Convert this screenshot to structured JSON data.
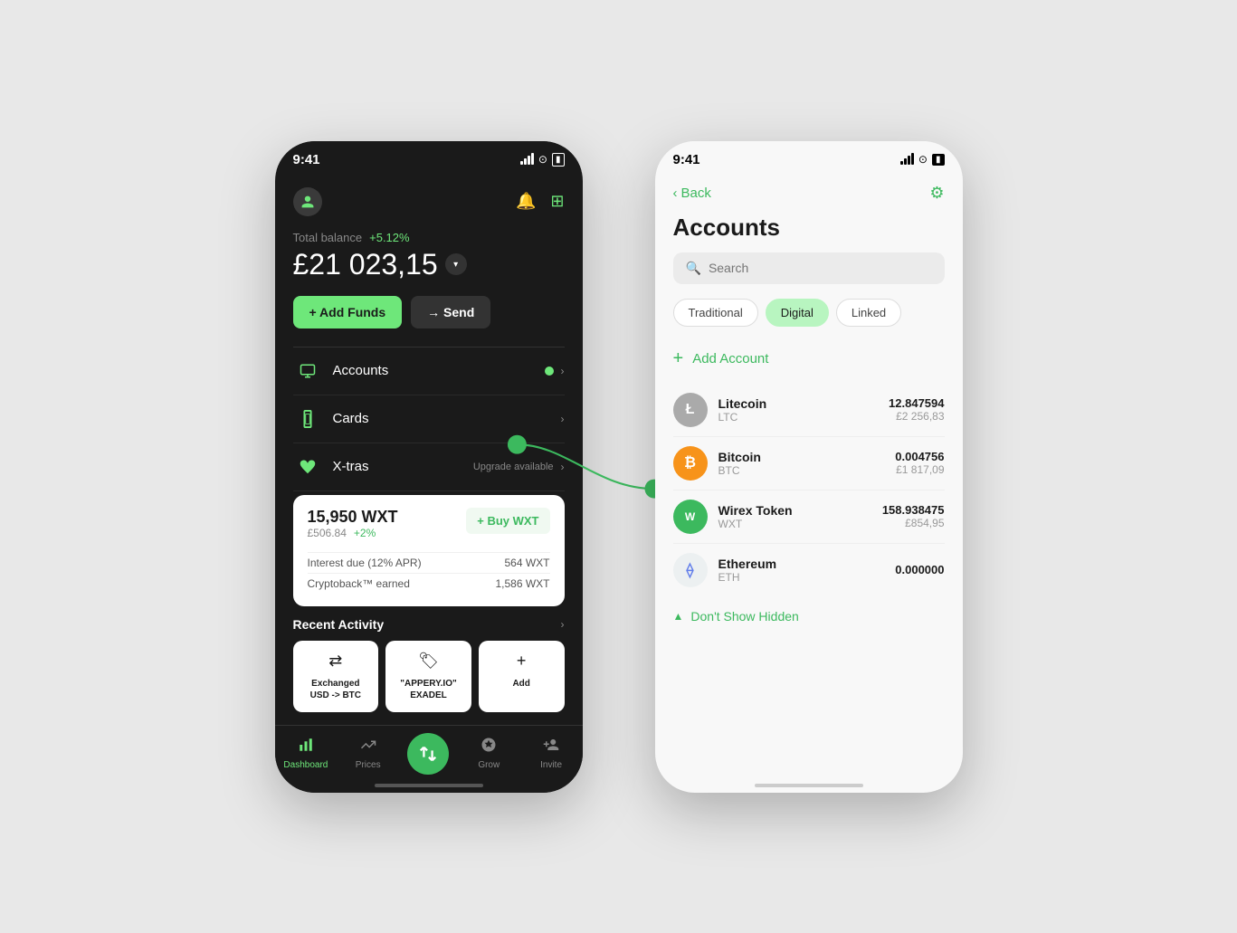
{
  "scene": {
    "background": "#e8e8e8"
  },
  "leftPhone": {
    "statusBar": {
      "time": "9:41"
    },
    "balance": {
      "label": "Total balance",
      "change": "+5.12%",
      "amount": "£21 023,15"
    },
    "buttons": {
      "addFunds": "+ Add Funds",
      "send": "→ Send"
    },
    "menuItems": [
      {
        "label": "Accounts",
        "icon": "accounts"
      },
      {
        "label": "Cards",
        "icon": "cards"
      },
      {
        "label": "X-tras",
        "icon": "xtras",
        "badge": "Upgrade available"
      }
    ],
    "wxtCard": {
      "amount": "15,950 WXT",
      "fiatValue": "£506.84",
      "change": "+2%",
      "buyLabel": "+ Buy WXT",
      "rows": [
        {
          "label": "Interest due (12% APR)",
          "value": "564 WXT"
        },
        {
          "label": "Cryptoback™ earned",
          "value": "1,586 WXT"
        }
      ]
    },
    "recentActivity": {
      "title": "Recent Activity",
      "items": [
        {
          "label": "Exchanged USD -> BTC",
          "icon": "exchange"
        },
        {
          "label": "\"APPERY.IO\" EXADEL",
          "icon": "tag"
        },
        {
          "label": "Add",
          "icon": "plus"
        }
      ]
    },
    "bottomNav": [
      {
        "label": "Dashboard",
        "icon": "bar-chart",
        "active": true
      },
      {
        "label": "Prices",
        "icon": "prices",
        "active": false
      },
      {
        "label": "",
        "icon": "transfer",
        "active": false,
        "center": true
      },
      {
        "label": "Grow",
        "icon": "grow",
        "active": false
      },
      {
        "label": "Invite",
        "icon": "invite",
        "active": false
      }
    ]
  },
  "rightPhone": {
    "statusBar": {
      "time": "9:41"
    },
    "nav": {
      "backLabel": "Back",
      "gearIcon": "settings"
    },
    "title": "Accounts",
    "search": {
      "placeholder": "Search"
    },
    "filterTabs": [
      {
        "label": "Traditional",
        "active": false
      },
      {
        "label": "Digital",
        "active": true
      },
      {
        "label": "Linked",
        "active": false
      }
    ],
    "addAccount": "+ Add Account",
    "accounts": [
      {
        "name": "Litecoin",
        "symbol": "LTC",
        "cryptoAmount": "12.847594",
        "fiatAmount": "£2 256,83",
        "iconColor": "#aaaaaa",
        "iconLabel": "Ł"
      },
      {
        "name": "Bitcoin",
        "symbol": "BTC",
        "cryptoAmount": "0.004756",
        "fiatAmount": "£1 817,09",
        "iconColor": "#f7931a",
        "iconLabel": "₿"
      },
      {
        "name": "Wirex Token",
        "symbol": "WXT",
        "cryptoAmount": "158.938475",
        "fiatAmount": "£854,95",
        "iconColor": "#3cb95e",
        "iconLabel": "W"
      },
      {
        "name": "Ethereum",
        "symbol": "ETH",
        "cryptoAmount": "0.000000",
        "fiatAmount": "",
        "iconColor": "#ecf0f1",
        "iconLabel": "⟠"
      }
    ],
    "dontShowHidden": "Don't Show Hidden"
  }
}
